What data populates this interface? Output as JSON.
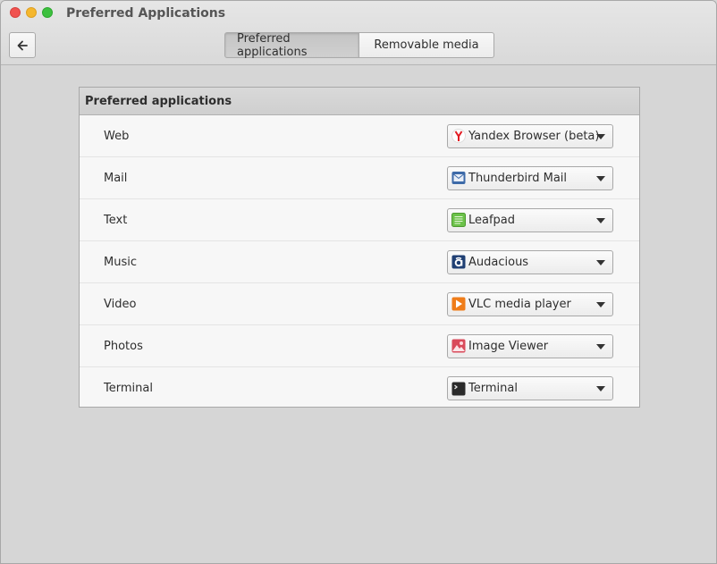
{
  "window": {
    "title": "Preferred Applications"
  },
  "header": {
    "back_icon": "arrow-left-icon",
    "tabs": [
      {
        "label": "Preferred applications",
        "active": true
      },
      {
        "label": "Removable media",
        "active": false
      }
    ]
  },
  "section": {
    "title": "Preferred applications",
    "rows": [
      {
        "label": "Web",
        "app": "Yandex Browser (beta)",
        "icon": "yandex-browser-icon"
      },
      {
        "label": "Mail",
        "app": "Thunderbird Mail",
        "icon": "thunderbird-icon"
      },
      {
        "label": "Text",
        "app": "Leafpad",
        "icon": "leafpad-icon"
      },
      {
        "label": "Music",
        "app": "Audacious",
        "icon": "audacious-icon"
      },
      {
        "label": "Video",
        "app": "VLC media player",
        "icon": "vlc-icon"
      },
      {
        "label": "Photos",
        "app": "Image Viewer",
        "icon": "image-viewer-icon"
      },
      {
        "label": "Terminal",
        "app": "Terminal",
        "icon": "terminal-icon"
      }
    ]
  },
  "colors": {
    "close": "#f0524f",
    "minimize": "#f5b72e",
    "maximize": "#3dc03f",
    "background": "#d6d6d6"
  }
}
